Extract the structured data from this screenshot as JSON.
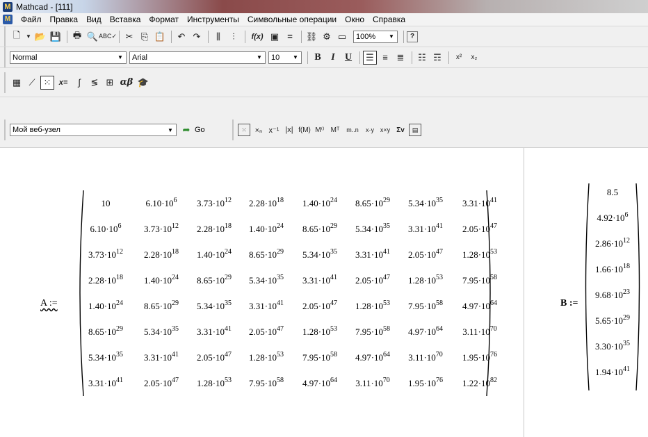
{
  "window": {
    "title": "Mathcad - [111]",
    "app_icon": "mathcad-logo-icon"
  },
  "menu": {
    "items": [
      "Файл",
      "Правка",
      "Вид",
      "Вставка",
      "Формат",
      "Инструменты",
      "Символьные операции",
      "Окно",
      "Справка"
    ]
  },
  "toolbar_format": {
    "style": "Normal",
    "font": "Arial",
    "size": "10",
    "bold": "B",
    "italic": "I",
    "underline": "U"
  },
  "toolbar_standard": {
    "zoom": "100%",
    "fx": "f(x)"
  },
  "toolbar_math": {
    "calc_label": "x=",
    "greek_label": "αβ"
  },
  "toolbar_web": {
    "address": "Мой веб-узел",
    "go_label": "Go"
  },
  "matrix_a": {
    "label": "A :=",
    "rows": [
      [
        [
          "10",
          ""
        ],
        [
          "6.10·10",
          "6"
        ],
        [
          "3.73·10",
          "12"
        ],
        [
          "2.28·10",
          "18"
        ],
        [
          "1.40·10",
          "24"
        ],
        [
          "8.65·10",
          "29"
        ],
        [
          "5.34·10",
          "35"
        ],
        [
          "3.31·10",
          "41"
        ]
      ],
      [
        [
          "6.10·10",
          "6"
        ],
        [
          "3.73·10",
          "12"
        ],
        [
          "2.28·10",
          "18"
        ],
        [
          "1.40·10",
          "24"
        ],
        [
          "8.65·10",
          "29"
        ],
        [
          "5.34·10",
          "35"
        ],
        [
          "3.31·10",
          "41"
        ],
        [
          "2.05·10",
          "47"
        ]
      ],
      [
        [
          "3.73·10",
          "12"
        ],
        [
          "2.28·10",
          "18"
        ],
        [
          "1.40·10",
          "24"
        ],
        [
          "8.65·10",
          "29"
        ],
        [
          "5.34·10",
          "35"
        ],
        [
          "3.31·10",
          "41"
        ],
        [
          "2.05·10",
          "47"
        ],
        [
          "1.28·10",
          "53"
        ]
      ],
      [
        [
          "2.28·10",
          "18"
        ],
        [
          "1.40·10",
          "24"
        ],
        [
          "8.65·10",
          "29"
        ],
        [
          "5.34·10",
          "35"
        ],
        [
          "3.31·10",
          "41"
        ],
        [
          "2.05·10",
          "47"
        ],
        [
          "1.28·10",
          "53"
        ],
        [
          "7.95·10",
          "58"
        ]
      ],
      [
        [
          "1.40·10",
          "24"
        ],
        [
          "8.65·10",
          "29"
        ],
        [
          "5.34·10",
          "35"
        ],
        [
          "3.31·10",
          "41"
        ],
        [
          "2.05·10",
          "47"
        ],
        [
          "1.28·10",
          "53"
        ],
        [
          "7.95·10",
          "58"
        ],
        [
          "4.97·10",
          "64"
        ]
      ],
      [
        [
          "8.65·10",
          "29"
        ],
        [
          "5.34·10",
          "35"
        ],
        [
          "3.31·10",
          "41"
        ],
        [
          "2.05·10",
          "47"
        ],
        [
          "1.28·10",
          "53"
        ],
        [
          "7.95·10",
          "58"
        ],
        [
          "4.97·10",
          "64"
        ],
        [
          "3.11·10",
          "70"
        ]
      ],
      [
        [
          "5.34·10",
          "35"
        ],
        [
          "3.31·10",
          "41"
        ],
        [
          "2.05·10",
          "47"
        ],
        [
          "1.28·10",
          "53"
        ],
        [
          "7.95·10",
          "58"
        ],
        [
          "4.97·10",
          "64"
        ],
        [
          "3.11·10",
          "70"
        ],
        [
          "1.95·10",
          "76"
        ]
      ],
      [
        [
          "3.31·10",
          "41"
        ],
        [
          "2.05·10",
          "47"
        ],
        [
          "1.28·10",
          "53"
        ],
        [
          "7.95·10",
          "58"
        ],
        [
          "4.97·10",
          "64"
        ],
        [
          "3.11·10",
          "70"
        ],
        [
          "1.95·10",
          "76"
        ],
        [
          "1.22·10",
          "82"
        ]
      ]
    ]
  },
  "vector_b": {
    "label": "B :=",
    "rows": [
      [
        "8.5",
        ""
      ],
      [
        "4.92·10",
        "6"
      ],
      [
        "2.86·10",
        "12"
      ],
      [
        "1.66·10",
        "18"
      ],
      [
        "9.68·10",
        "23"
      ],
      [
        "5.65·10",
        "29"
      ],
      [
        "3.30·10",
        "35"
      ],
      [
        "1.94·10",
        "41"
      ]
    ]
  }
}
